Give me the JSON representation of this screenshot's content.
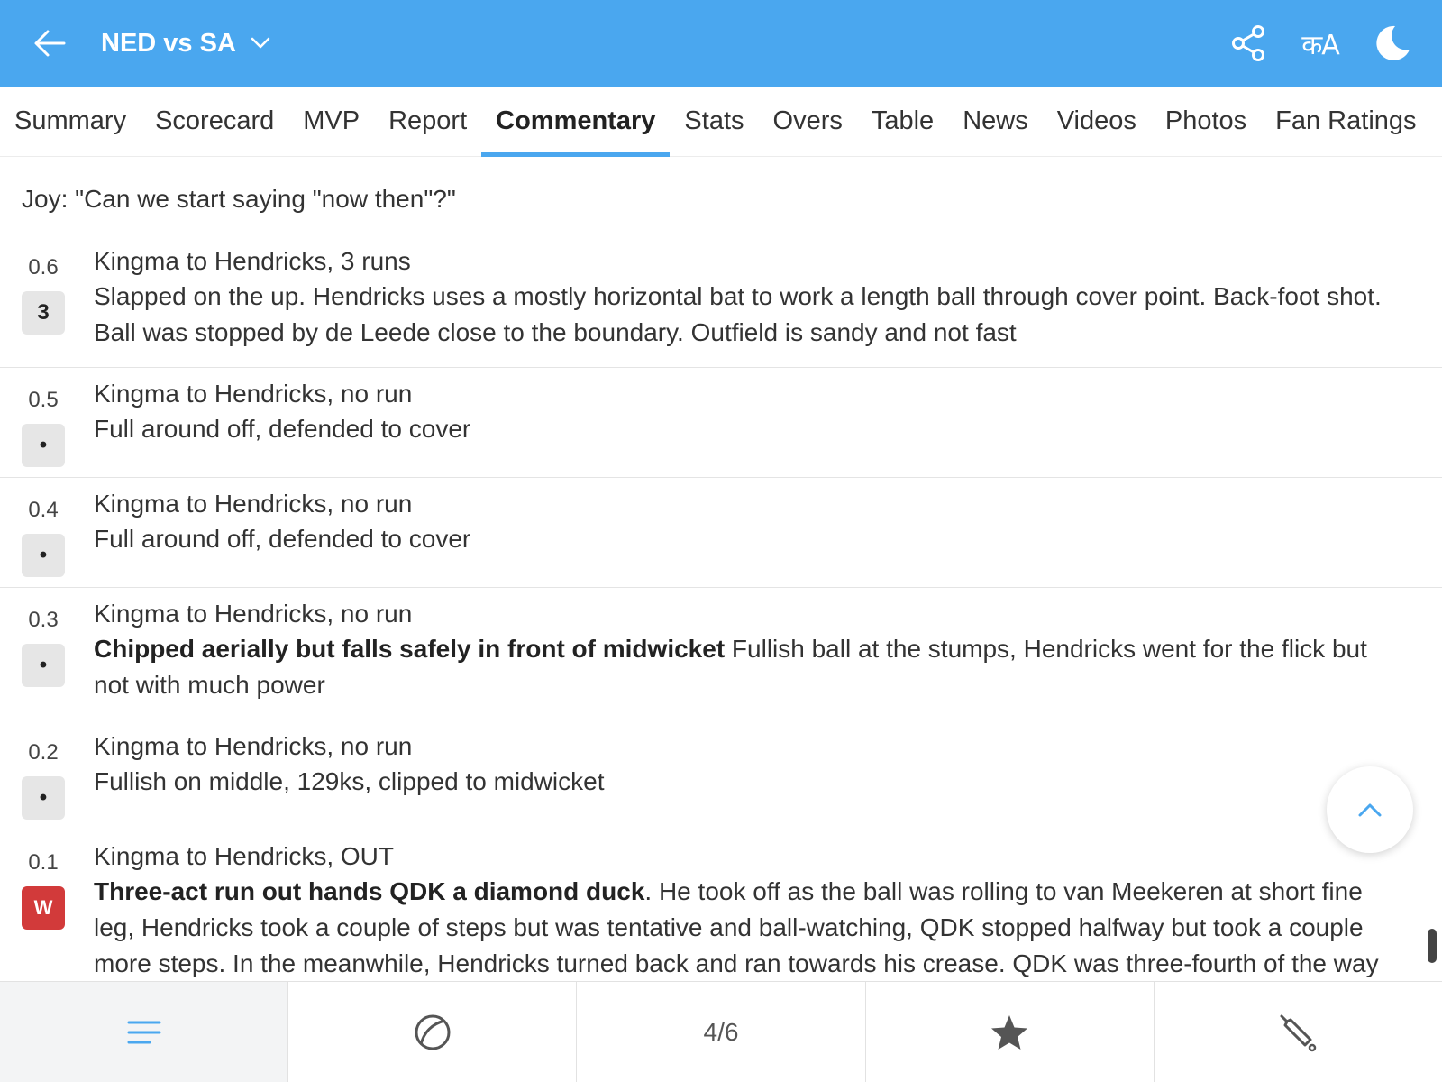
{
  "header": {
    "title": "NED vs SA",
    "lang_label": "कA",
    "icons": {
      "back": "arrow-left-icon",
      "dropdown": "chevron-down-icon",
      "share": "share-icon",
      "language": "language-icon",
      "theme": "moon-icon"
    },
    "colors": {
      "bar": "#4aa7ef",
      "text": "#ffffff"
    }
  },
  "tabs": [
    {
      "label": "Summary"
    },
    {
      "label": "Scorecard"
    },
    {
      "label": "MVP"
    },
    {
      "label": "Report"
    },
    {
      "label": "Commentary",
      "active": true
    },
    {
      "label": "Stats"
    },
    {
      "label": "Overs"
    },
    {
      "label": "Table"
    },
    {
      "label": "News"
    },
    {
      "label": "Videos"
    },
    {
      "label": "Photos"
    },
    {
      "label": "Fan Ratings"
    }
  ],
  "commentary": {
    "intro": "Joy: \"Can we start saying \"now then\"?\"",
    "balls": [
      {
        "over": "0.6",
        "result": "3",
        "headline": "Kingma to Hendricks, 3 runs",
        "bold": "",
        "text": "Slapped on the up. Hendricks uses a mostly horizontal bat to work a length ball through cover point. Back-foot shot. Ball was stopped by de Leede close to the boundary. Outfield is sandy and not fast"
      },
      {
        "over": "0.5",
        "result": "•",
        "headline": "Kingma to Hendricks, no run",
        "bold": "",
        "text": "Full around off, defended to cover"
      },
      {
        "over": "0.4",
        "result": "•",
        "headline": "Kingma to Hendricks, no run",
        "bold": "",
        "text": "Full around off, defended to cover"
      },
      {
        "over": "0.3",
        "result": "•",
        "headline": "Kingma to Hendricks, no run",
        "bold": "Chipped aerially but falls safely in front of midwicket",
        "text": " Fullish ball at the stumps, Hendricks went for the flick but not with much power"
      },
      {
        "over": "0.2",
        "result": "•",
        "headline": "Kingma to Hendricks, no run",
        "bold": "",
        "text": "Fullish on middle, 129ks, clipped to midwicket"
      },
      {
        "over": "0.1",
        "result": "W",
        "wicket": true,
        "headline": "Kingma to Hendricks, OUT",
        "bold": "Three-act run out hands QDK a diamond duck",
        "text": ". He took off as the ball was rolling to van Meekeren at short fine leg, Hendricks took a couple of steps but was tentative and ball-watching, QDK stopped halfway but took a couple more steps. In the meanwhile, Hendricks turned back and ran towards his crease. QDK was three-fourth of the way"
      }
    ],
    "colors": {
      "wicket_badge": "#d23a3a",
      "neutral_badge": "#e6e6e6"
    }
  },
  "scroll_top": {
    "icon": "chevron-up-icon"
  },
  "bottom_nav": {
    "items": [
      {
        "icon": "list-icon"
      },
      {
        "icon": "cricket-ball-icon"
      },
      {
        "label": "4/6"
      },
      {
        "icon": "star-icon"
      },
      {
        "icon": "cricket-bat-icon"
      }
    ]
  }
}
